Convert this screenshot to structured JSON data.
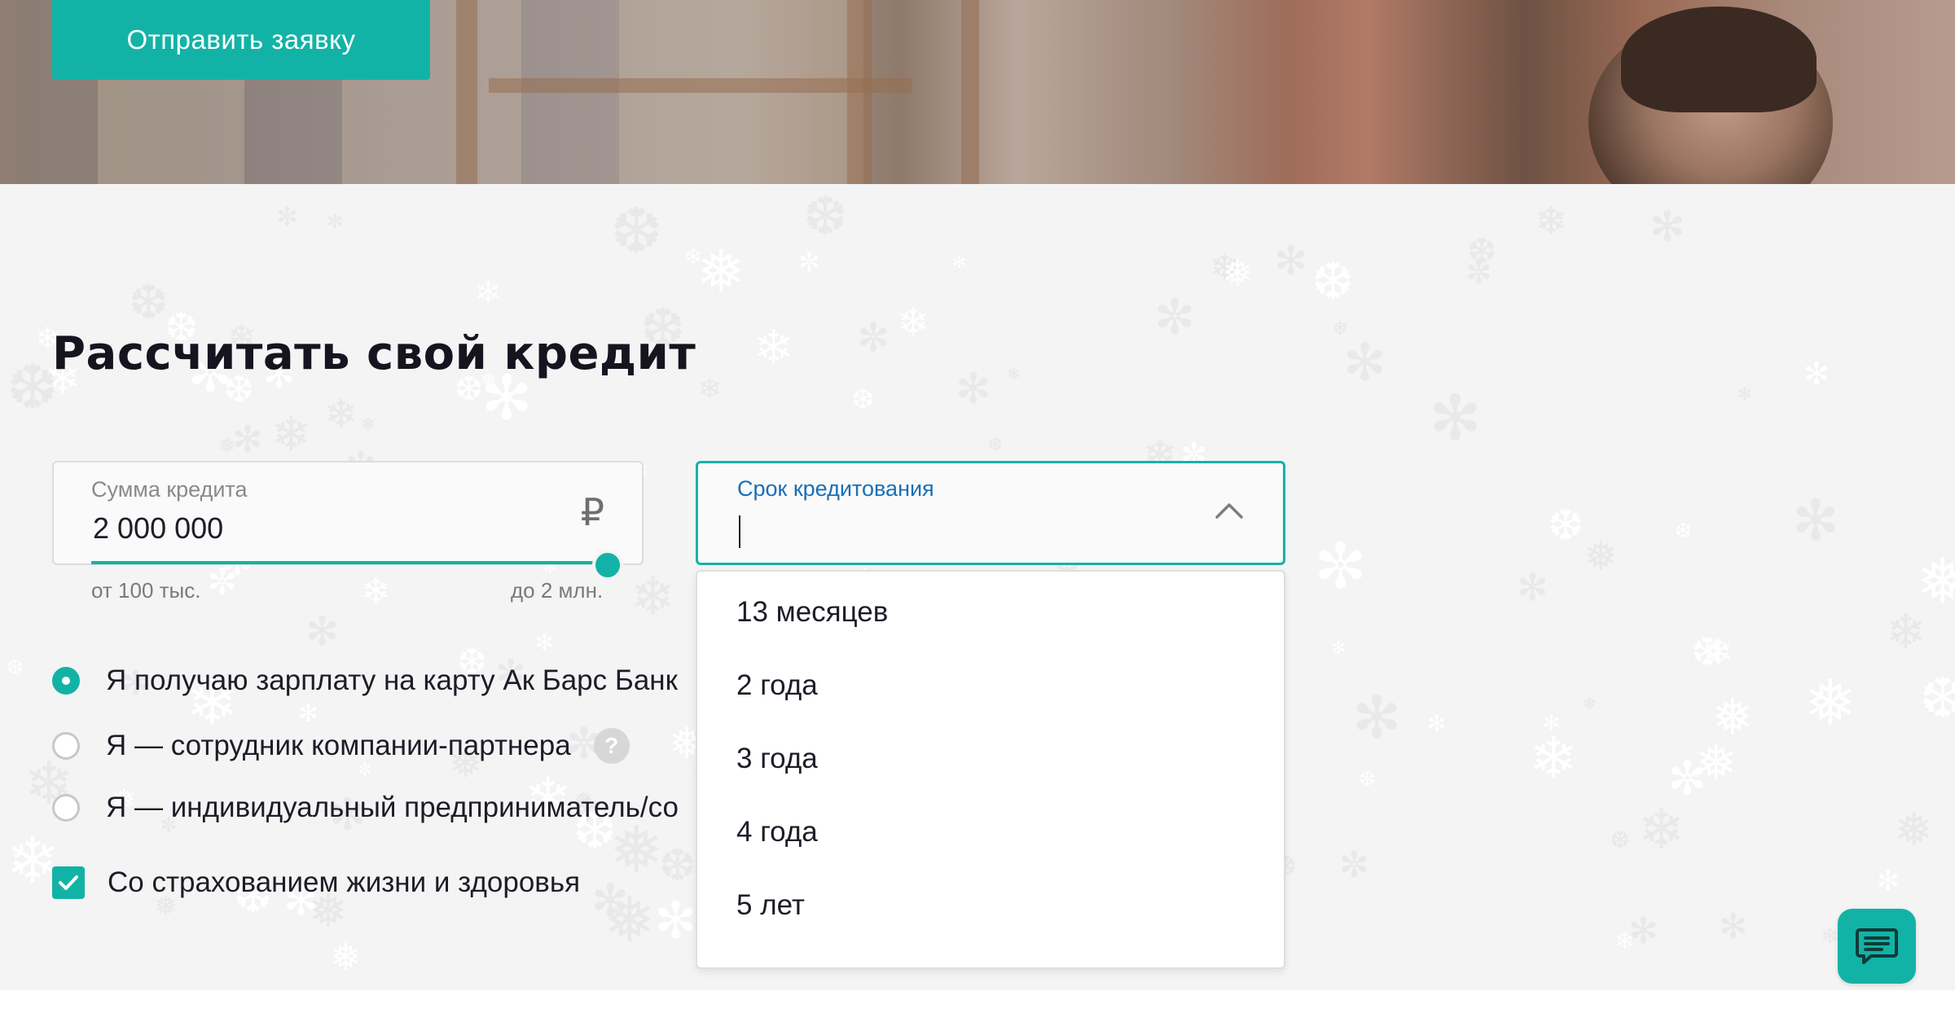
{
  "hero": {
    "submit_label": "Отправить заявку"
  },
  "calculator": {
    "title": "Рассчитать свой кредит",
    "amount": {
      "label": "Сумма кредита",
      "value": "2 000 000",
      "currency_symbol": "₽",
      "range_min": "от 100 тыс.",
      "range_max": "до 2 млн.",
      "slider_fraction": 1.0
    },
    "term": {
      "label": "Срок кредитования",
      "value": "",
      "expanded": true,
      "options": [
        "13 месяцев",
        "2 года",
        "3 года",
        "4 года",
        "5 лет"
      ]
    },
    "income_options": [
      {
        "label": "Я получаю зарплату на карту Ак Барс Банк",
        "checked": true
      },
      {
        "label": "Я — сотрудник компании-партнера",
        "checked": false,
        "help_icon": "?"
      },
      {
        "label": "Я — индивидуальный предприниматель/со",
        "checked": false
      }
    ],
    "insurance": {
      "label": "Со страхованием жизни и здоровья",
      "checked": true
    }
  },
  "colors": {
    "accent": "#12b3a6",
    "label_blue": "#1a6fb5",
    "text": "#1d1d28",
    "section_bg": "#f4f4f4"
  },
  "icons": {
    "currency": "ruble-icon",
    "dropdown": "chevron-up-icon",
    "help": "question-mark-icon",
    "checkbox": "check-icon",
    "chat": "chat-bubble-icon",
    "background": "snowflake-icon"
  }
}
